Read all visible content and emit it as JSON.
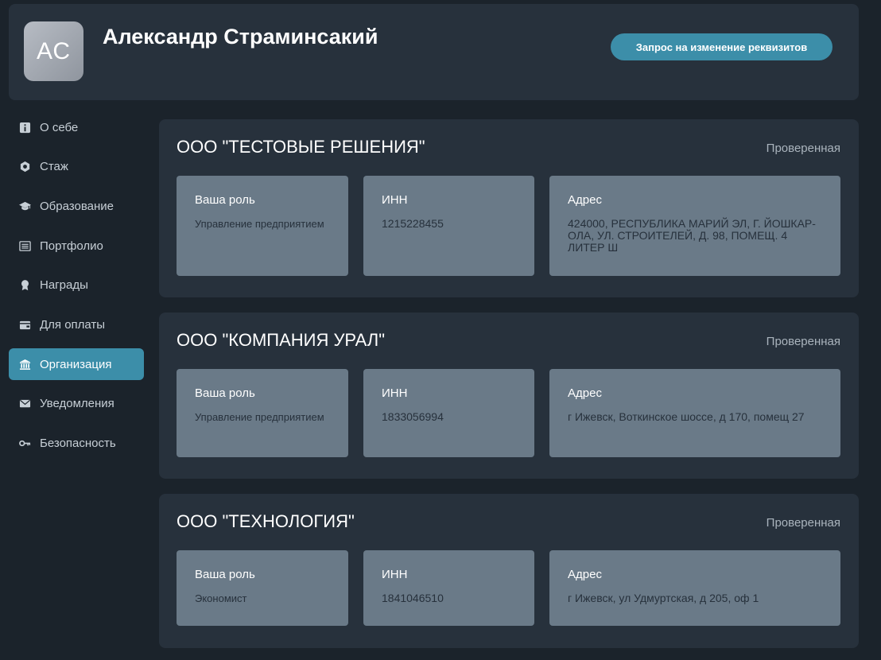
{
  "profile": {
    "initials": "АС",
    "name": "Александр Страминсакий",
    "request_button": "Запрос на изменение реквизитов"
  },
  "sidebar": {
    "items": [
      {
        "label": "О себе",
        "icon": "info-icon"
      },
      {
        "label": "Стаж",
        "icon": "gear-icon"
      },
      {
        "label": "Образование",
        "icon": "graduation-cap-icon"
      },
      {
        "label": "Портфолио",
        "icon": "list-icon"
      },
      {
        "label": "Награды",
        "icon": "award-icon"
      },
      {
        "label": "Для оплаты",
        "icon": "wallet-icon"
      },
      {
        "label": "Организация",
        "icon": "bank-icon",
        "active": true
      },
      {
        "label": "Уведомления",
        "icon": "envelope-icon"
      },
      {
        "label": "Безопасность",
        "icon": "key-icon"
      }
    ]
  },
  "organizations": [
    {
      "title": "ООО \"ТЕСТОВЫЕ РЕШЕНИЯ\"",
      "status": "Проверенная",
      "role_label": "Ваша роль",
      "role": "Управление предприятием",
      "inn_label": "ИНН",
      "inn": "1215228455",
      "address_label": "Адрес",
      "address": "424000, РЕСПУБЛИКА МАРИЙ ЭЛ, Г. ЙОШКАР-ОЛА, УЛ. СТРОИТЕЛЕЙ, Д. 98, ПОМЕЩ. 4 ЛИТЕР Ш"
    },
    {
      "title": "ООО \"КОМПАНИЯ УРАЛ\"",
      "status": "Проверенная",
      "role_label": "Ваша роль",
      "role": "Управление предприятием",
      "inn_label": "ИНН",
      "inn": "1833056994",
      "address_label": "Адрес",
      "address": "г Ижевск, Воткинское шоссе, д 170, помещ 27"
    },
    {
      "title": "ООО \"ТЕХНОЛОГИЯ\"",
      "status": "Проверенная",
      "role_label": "Ваша роль",
      "role": "Экономист",
      "inn_label": "ИНН",
      "inn": "1841046510",
      "address_label": "Адрес",
      "address": "г Ижевск, ул Удмуртская, д 205, оф 1"
    }
  ],
  "colors": {
    "background": "#1b232b",
    "card": "#27313c",
    "info_box": "#6a7a88",
    "accent": "#3c8ea9"
  }
}
